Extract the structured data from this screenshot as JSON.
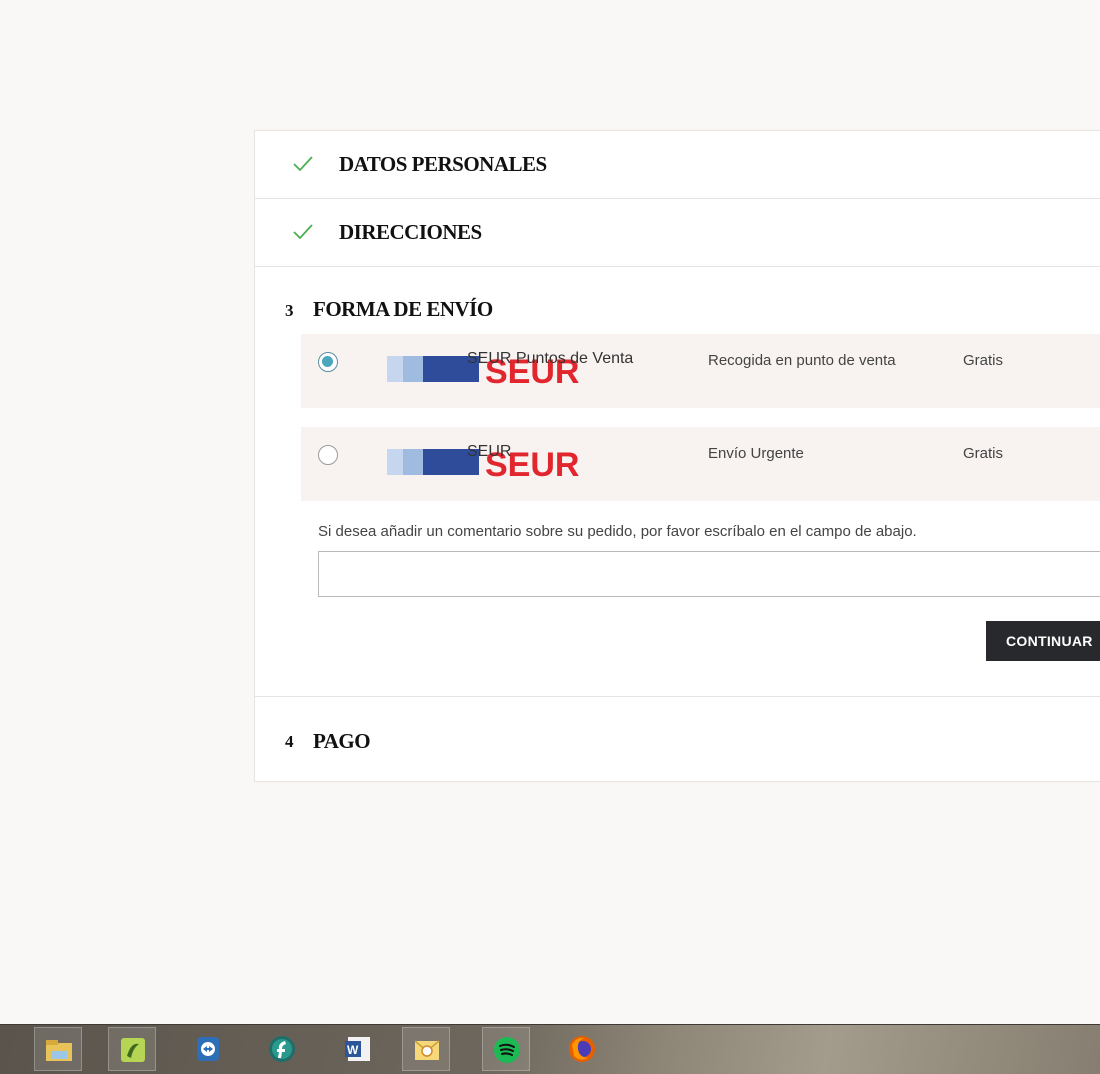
{
  "checkout": {
    "step1": {
      "title": "DATOS PERSONALES"
    },
    "step2": {
      "title": "DIRECCIONES"
    },
    "step3": {
      "number": "3",
      "title": "FORMA DE ENVÍO",
      "options": [
        {
          "carrier": "SEUR Puntos de Venta",
          "logo_text": "SEUR",
          "description": "Recogida en punto de venta",
          "price": "Gratis",
          "selected": true
        },
        {
          "carrier": "SEUR",
          "logo_text": "SEUR",
          "description": "Envío Urgente",
          "price": "Gratis",
          "selected": false
        }
      ],
      "comment_label": "Si desea añadir un comentario sobre su pedido, por favor escríbalo en el campo de abajo.",
      "comment_value": "",
      "continue_label": "CONTINUAR"
    },
    "step4": {
      "number": "4",
      "title": "PAGO"
    }
  },
  "colors": {
    "check": "#4caf50",
    "radio_selected": "#4ba8bc",
    "logo_red": "#e1262d",
    "logo_blue_dark": "#2f4c9a",
    "logo_blue_light": "#9fbbe0",
    "button_bg": "#27292d"
  },
  "taskbar": {
    "icons": [
      "file-explorer-icon",
      "app-green-icon",
      "teamviewer-icon",
      "app-flash-icon",
      "word-icon",
      "outlook-icon",
      "spotify-icon",
      "firefox-icon"
    ]
  }
}
